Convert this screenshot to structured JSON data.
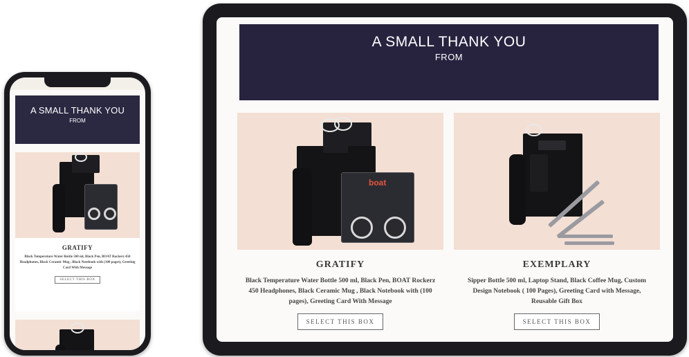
{
  "phone": {
    "hero": {
      "title": "A SMALL THANK YOU",
      "subtitle": "FROM"
    },
    "product": {
      "name": "GRATIFY",
      "description": "Black Temperature Water Bottle 500 ml, Black Pen, BOAT Rockerz 450 Headphones, Black Ceramic Mug , Black Notebook with (100 pages), Greeting Card With Message",
      "button_label": "SELECT THIS BOX"
    }
  },
  "tablet": {
    "hero": {
      "title": "A SMALL THANK YOU",
      "subtitle": "FROM"
    },
    "products": [
      {
        "name": "GRATIFY",
        "description": "Black Temperature Water Bottle 500 ml, Black Pen, BOAT Rockerz 450 Headphones, Black Ceramic Mug , Black Notebook with (100 pages), Greeting Card With Message",
        "button_label": "SELECT THIS BOX",
        "image_brand_text": "boat"
      },
      {
        "name": "EXEMPLARY",
        "description": "Sipper Bottle 500 ml, Laptop Stand, Black Coffee Mug, Custom Design Notebook ( 100 Pages), Greeting Card with Message, Reusable Gift Box",
        "button_label": "SELECT THIS BOX"
      }
    ]
  },
  "colors": {
    "hero_bg": "#27233f",
    "product_bg": "#f3dfd4",
    "device_frame": "#1b1b1f"
  }
}
